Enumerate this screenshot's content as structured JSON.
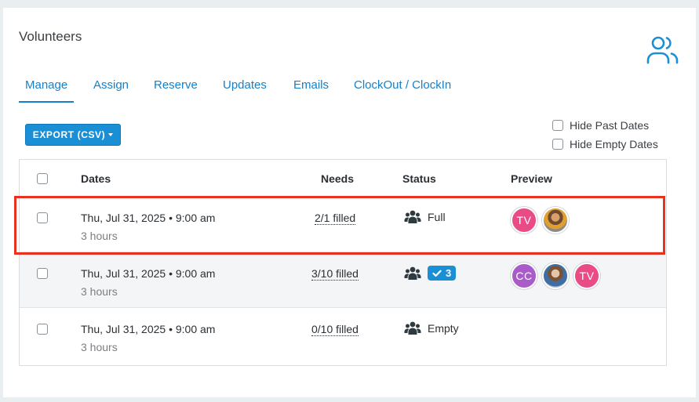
{
  "header": {
    "title": "Volunteers",
    "icon": "users-icon"
  },
  "tabs": [
    {
      "label": "Manage",
      "active": true
    },
    {
      "label": "Assign",
      "active": false
    },
    {
      "label": "Reserve",
      "active": false
    },
    {
      "label": "Updates",
      "active": false
    },
    {
      "label": "Emails",
      "active": false
    },
    {
      "label": "ClockOut / ClockIn",
      "active": false
    }
  ],
  "toolbar": {
    "export_label": "EXPORT (CSV)"
  },
  "filters": {
    "hide_past": "Hide Past Dates",
    "hide_empty": "Hide Empty Dates"
  },
  "table": {
    "columns": {
      "dates": "Dates",
      "needs": "Needs",
      "status": "Status",
      "preview": "Preview"
    },
    "rows": [
      {
        "date": "Thu, Jul 31, 2025 • 9:00 am",
        "duration": "3 hours",
        "needs": "2/1 filled",
        "status": "Full",
        "avatars": [
          {
            "initials": "TV",
            "color": "#e94b86"
          },
          {
            "initials": "",
            "color": "#8a6a4a",
            "photo": true
          }
        ]
      },
      {
        "date": "Thu, Jul 31, 2025 • 9:00 am",
        "duration": "3 hours",
        "needs": "3/10 filled",
        "status_badge": "3",
        "avatars": [
          {
            "initials": "CC",
            "color": "#a95cc9"
          },
          {
            "initials": "",
            "color": "#9aa7b3",
            "photo": true
          },
          {
            "initials": "TV",
            "color": "#e94b86"
          }
        ]
      },
      {
        "date": "Thu, Jul 31, 2025 • 9:00 am",
        "duration": "3 hours",
        "needs": "0/10 filled",
        "status": "Empty",
        "avatars": []
      }
    ]
  },
  "colors": {
    "accent": "#1b8fd6",
    "highlight": "#e8311f"
  }
}
